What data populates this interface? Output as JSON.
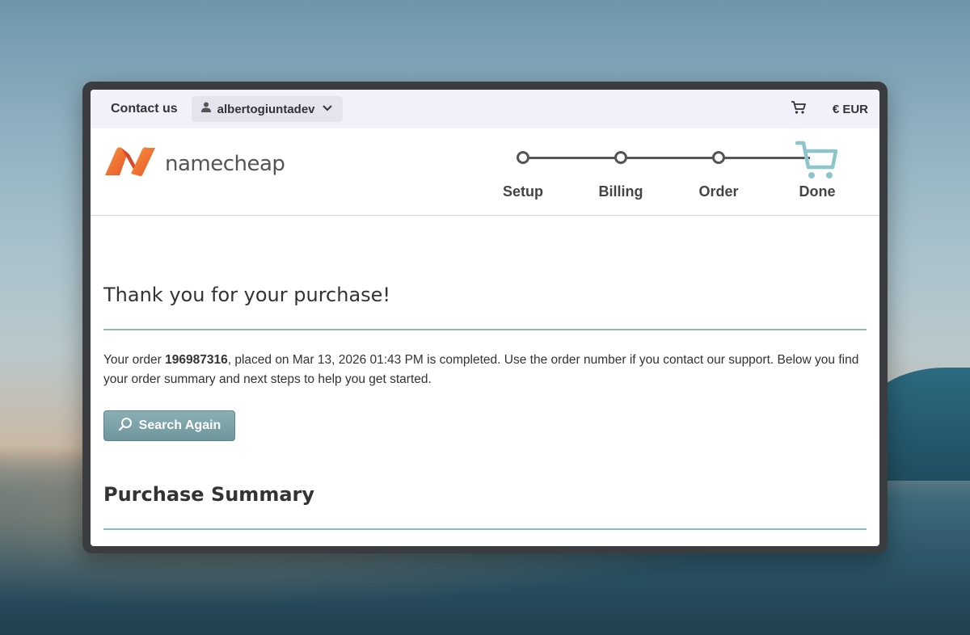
{
  "topbar": {
    "contact_label": "Contact us",
    "username": "albertogiuntadev",
    "currency": "€ EUR"
  },
  "logo": {
    "text": "namecheap"
  },
  "steps": [
    {
      "label": "Setup"
    },
    {
      "label": "Billing"
    },
    {
      "label": "Order"
    },
    {
      "label": "Done"
    }
  ],
  "main": {
    "title": "Thank you for your purchase!",
    "order_prefix": "Your order ",
    "order_number": "196987316",
    "order_suffix": ", placed on Mar 13, 2026 01:43 PM is completed. Use the order number if you contact our support. Below you find your order summary and next steps to help you get started.",
    "search_again_label": "Search Again",
    "summary_title": "Purchase Summary"
  },
  "colors": {
    "accent": "#8fb8bf",
    "button": "#7ca2a7",
    "logo_orange": "#f26b3a"
  }
}
